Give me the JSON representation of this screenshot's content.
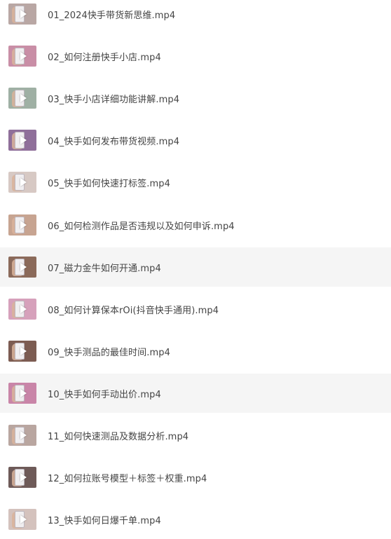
{
  "files": [
    {
      "name": "01_2024快手带货新思维.mp4",
      "thumb_color": "#b9a7a4",
      "alt": false
    },
    {
      "name": "02_如何注册快手小店.mp4",
      "thumb_color": "#c98ea6",
      "alt": false
    },
    {
      "name": "03_快手小店详细功能讲解.mp4",
      "thumb_color": "#9fb0a4",
      "alt": false
    },
    {
      "name": "04_快手如何发布带货视频.mp4",
      "thumb_color": "#8f6f9a",
      "alt": false
    },
    {
      "name": "05_快手如何快速打标签.mp4",
      "thumb_color": "#d7c9c4",
      "alt": false
    },
    {
      "name": "06_如何检测作品是否违规以及如何申诉.mp4",
      "thumb_color": "#c7a491",
      "alt": false
    },
    {
      "name": "07_磁力金牛如何开通.mp4",
      "thumb_color": "#8b6a5a",
      "alt": true
    },
    {
      "name": "08_如何计算保本rOi(抖音快手通用).mp4",
      "thumb_color": "#d6a1bb",
      "alt": false
    },
    {
      "name": "09_快手测品的最佳时间.mp4",
      "thumb_color": "#7c5c52",
      "alt": false
    },
    {
      "name": "10_快手如何手动出价.mp4",
      "thumb_color": "#c985a8",
      "alt": true
    },
    {
      "name": "11_如何快速测品及数据分析.mp4",
      "thumb_color": "#b9a6a0",
      "alt": false
    },
    {
      "name": "12_如何拉账号模型＋标签＋权重.mp4",
      "thumb_color": "#6e5a58",
      "alt": false
    },
    {
      "name": "13_快手如何日爆千单.mp4",
      "thumb_color": "#d4c2bd",
      "alt": false
    }
  ],
  "icons": {
    "thumbnail": "video-thumbnail-icon",
    "play": "play-icon"
  }
}
